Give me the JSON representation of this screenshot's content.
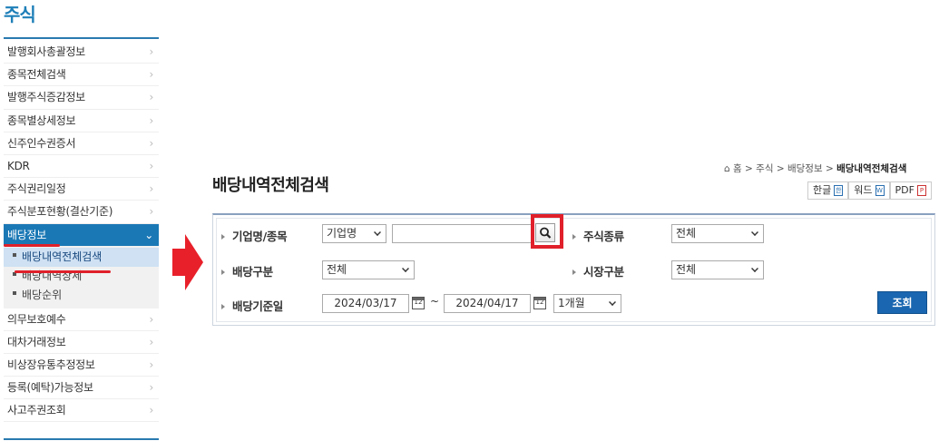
{
  "sidebar": {
    "title": "주식",
    "items_top": [
      {
        "label": "발행회사총괄정보"
      },
      {
        "label": "종목전체검색"
      },
      {
        "label": "발행주식증감정보"
      },
      {
        "label": "종목별상세정보"
      },
      {
        "label": "신주인수권증서"
      },
      {
        "label": "KDR"
      },
      {
        "label": "주식권리일정"
      },
      {
        "label": "주식분포현황(결산기준)"
      }
    ],
    "active": {
      "label": "배당정보"
    },
    "sub_items": [
      {
        "label": "배당내역전체검색"
      },
      {
        "label": "배당내역상세"
      },
      {
        "label": "배당순위"
      }
    ],
    "items_bottom": [
      {
        "label": "의무보호예수"
      },
      {
        "label": "대차거래정보"
      },
      {
        "label": "비상장유통추정정보"
      },
      {
        "label": "등록(예탁)가능정보"
      },
      {
        "label": "사고주권조회"
      }
    ]
  },
  "breadcrumb": {
    "home": "홈",
    "l1": "주식",
    "l2": "배당정보",
    "current": "배당내역전체검색"
  },
  "page_title": "배당내역전체검색",
  "export": {
    "hangul": "한글",
    "word": "워드",
    "pdf": "PDF"
  },
  "form": {
    "company_label": "기업명/종목",
    "company_type_value": "기업명",
    "company_input_value": "",
    "stock_type_label": "주식종류",
    "stock_type_value": "전체",
    "dividend_type_label": "배당구분",
    "dividend_type_value": "전체",
    "market_label": "시장구분",
    "market_value": "전체",
    "date_label": "배당기준일",
    "date_from": "2024/03/17",
    "date_sep": "~",
    "date_to": "2024/04/17",
    "period_value": "1개월",
    "query_button": "조회"
  },
  "colors": {
    "accent": "#1a78b5",
    "highlight": "#e0202a",
    "query": "#1a66b0"
  }
}
